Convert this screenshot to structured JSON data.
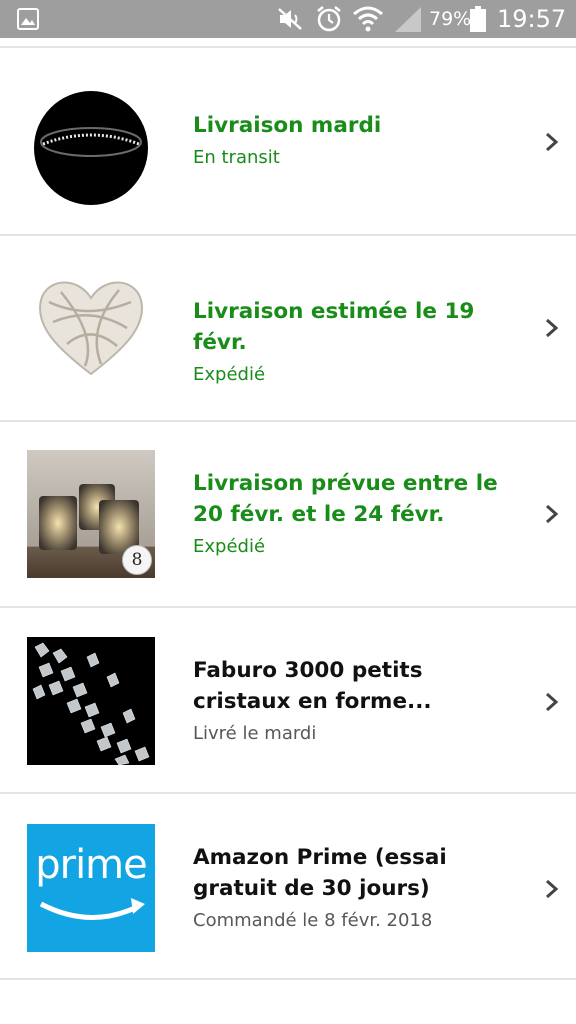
{
  "status_bar": {
    "battery_percent": "79%",
    "time": "19:57",
    "icons": [
      "gallery-icon",
      "mute-icon",
      "alarm-icon",
      "wifi-icon",
      "signal-icon",
      "battery-icon"
    ]
  },
  "orders": [
    {
      "title": "Livraison mardi",
      "status": "En transit",
      "highlight": true,
      "thumb": "black-round-headband"
    },
    {
      "title": "Livraison estimée le 19 févr.",
      "status": "Expédié",
      "highlight": true,
      "thumb": "white-wicker-heart"
    },
    {
      "title": "Livraison prévue entre le 20 févr. et le 24 févr.",
      "status": "Expédié",
      "highlight": true,
      "thumb": "mercury-glass-candle-holders",
      "quantity": "8"
    },
    {
      "title": "Faburo 3000 petits cristaux en forme...",
      "status": "Livré le mardi",
      "highlight": false,
      "thumb": "clear-crystals-on-black"
    },
    {
      "title": "Amazon Prime (essai gratuit de 30 jours)",
      "status": "Commandé le 8 févr. 2018",
      "highlight": false,
      "thumb": "prime-logo",
      "thumb_text": "prime"
    }
  ],
  "colors": {
    "status_bar": "#9e9e9e",
    "delivery_green": "#198c19",
    "prime_blue": "#12a4e3",
    "divider": "#e3e3e3"
  }
}
